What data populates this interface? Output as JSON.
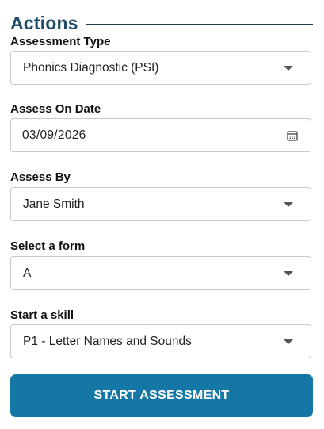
{
  "section": {
    "title": "Actions"
  },
  "fields": {
    "assessment_type": {
      "label": "Assessment Type",
      "value": "Phonics Diagnostic (PSI)",
      "icon": "chevron-down-icon"
    },
    "assess_on_date": {
      "label": "Assess On Date",
      "value": "03/09/2026",
      "icon": "calendar-icon"
    },
    "assess_by": {
      "label": "Assess By",
      "value": "Jane Smith",
      "icon": "chevron-down-icon"
    },
    "select_form": {
      "label": "Select a form",
      "value": "A",
      "icon": "chevron-down-icon"
    },
    "start_skill": {
      "label": "Start a skill",
      "value": "P1 - Letter Names and Sounds",
      "icon": "chevron-down-icon"
    }
  },
  "actions": {
    "start_label": "START ASSESSMENT"
  },
  "colors": {
    "title": "#1f4f66",
    "primary_button": "#1577a6",
    "border": "#c9c9c9"
  }
}
